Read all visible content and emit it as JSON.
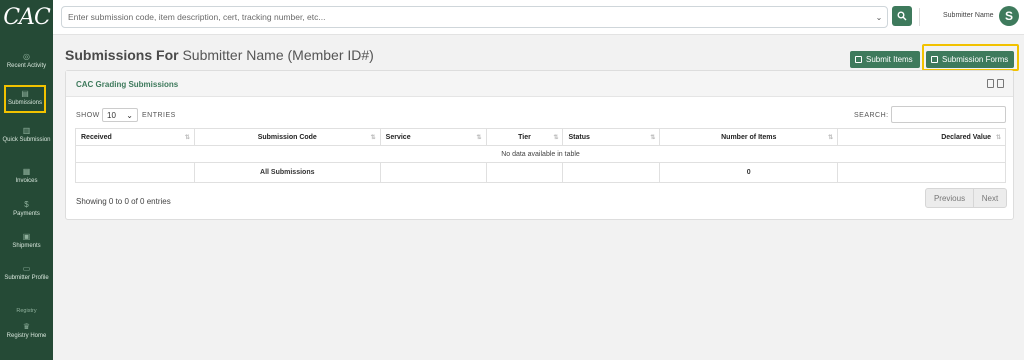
{
  "app": {
    "logo_text": "CAC"
  },
  "sidebar": {
    "items": [
      {
        "label": "Recent Activity",
        "icon": "clock-icon"
      },
      {
        "label": "Submissions",
        "icon": "document-icon"
      },
      {
        "label": "Quick Submission",
        "icon": "documents-icon"
      },
      {
        "label": "Invoices",
        "icon": "invoice-icon"
      },
      {
        "label": "Payments",
        "icon": "dollar-icon"
      },
      {
        "label": "Shipments",
        "icon": "box-icon"
      },
      {
        "label": "Submitter Profile",
        "icon": "id-card-icon"
      },
      {
        "label": "Registry Home",
        "icon": "trophy-icon"
      }
    ],
    "section_registry": "Registry"
  },
  "topbar": {
    "search_placeholder": "Enter submission code, item description, cert, tracking number, etc...",
    "user_name": "Submitter Name",
    "avatar_letter": "S"
  },
  "header": {
    "title_prefix": "Submissions For",
    "title_name": "Submitter Name (Member ID#)",
    "submit_items_label": "Submit Items",
    "submission_forms_label": "Submission Forms"
  },
  "card": {
    "title": "CAC Grading Submissions",
    "show_label": "SHOW",
    "entries_value": "10",
    "entries_label": "ENTRIES",
    "search_label": "SEARCH:",
    "columns": [
      "Received",
      "Submission Code",
      "Service",
      "Tier",
      "Status",
      "Number of Items",
      "Declared Value"
    ],
    "empty_message": "No data available in table",
    "footer": {
      "label": "All Submissions",
      "count": "0"
    },
    "info": "Showing 0 to 0 of 0 entries",
    "pager": {
      "previous": "Previous",
      "next": "Next"
    }
  },
  "colors": {
    "sidebar": "#254a36",
    "accent": "#3e7a5c",
    "highlight": "#f2c200"
  }
}
